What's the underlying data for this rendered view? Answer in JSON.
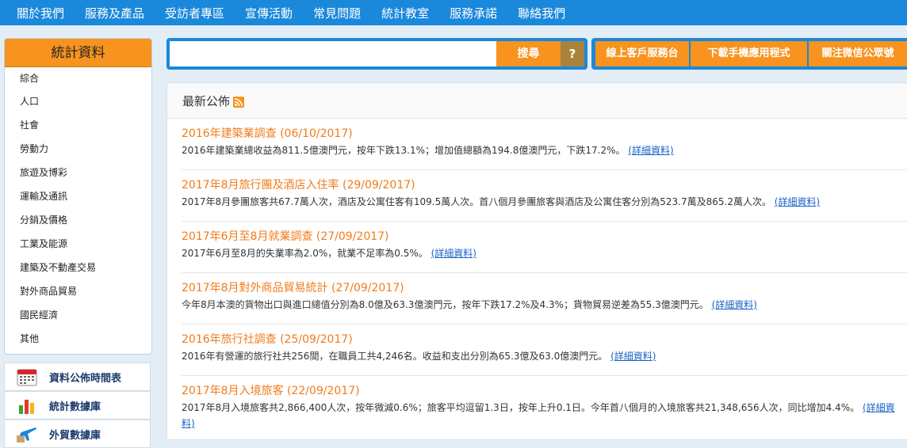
{
  "topnav": {
    "items": [
      "關於我們",
      "服務及產品",
      "受訪者專區",
      "宣傳活動",
      "常見問題",
      "統計教室",
      "服務承諾",
      "聯絡我們"
    ]
  },
  "sidebar": {
    "title": "統計資料",
    "items": [
      "綜合",
      "人口",
      "社會",
      "勞動力",
      "旅遊及博彩",
      "運輸及通訊",
      "分銷及價格",
      "工業及能源",
      "建築及不動產交易",
      "對外商品貿易",
      "國民經濟",
      "其他"
    ]
  },
  "quicklinks": [
    {
      "label": "資料公佈時間表",
      "icon": "calendar-icon"
    },
    {
      "label": "統計數據庫",
      "icon": "bar-chart-icon"
    },
    {
      "label": "外貿數據庫",
      "icon": "airplane-icon"
    }
  ],
  "search": {
    "placeholder": "",
    "value": "",
    "button_label": "搜尋",
    "help_label": "?"
  },
  "actions": [
    "線上客戶服務台",
    "下載手機應用程式",
    "關注微信公眾號"
  ],
  "main": {
    "title": "最新公佈",
    "more_label": "(詳細資料)",
    "news": [
      {
        "title": "2016年建築業調查 (06/10/2017)",
        "desc": "2016年建築業總收益為811.5億澳門元，按年下跌13.1%；增加值總額為194.8億澳門元，下跌17.2%。"
      },
      {
        "title": "2017年8月旅行團及酒店入住率 (29/09/2017)",
        "desc": "2017年8月參團旅客共67.7萬人次，酒店及公寓住客有109.5萬人次。首八個月參團旅客與酒店及公寓住客分別為523.7萬及865.2萬人次。"
      },
      {
        "title": "2017年6月至8月就業調查 (27/09/2017)",
        "desc": "2017年6月至8月的失業率為2.0%，就業不足率為0.5%。"
      },
      {
        "title": "2017年8月對外商品貿易統計 (27/09/2017)",
        "desc": "今年8月本澳的貨物出口與進口總值分別為8.0億及63.3億澳門元，按年下跌17.2%及4.3%；貨物貿易逆差為55.3億澳門元。"
      },
      {
        "title": "2016年旅行社調查 (25/09/2017)",
        "desc": "2016年有營運的旅行社共256間，在職員工共4,246名。收益和支出分別為65.3億及63.0億澳門元。"
      },
      {
        "title": "2017年8月入境旅客 (22/09/2017)",
        "desc": "2017年8月入境旅客共2,866,400人次，按年微減0.6%；旅客平均逗留1.3日，按年上升0.1日。今年首八個月的入境旅客共21,348,656人次，同比增加4.4%。"
      }
    ]
  },
  "colors": {
    "nav_blue": "#1a88db",
    "accent_orange": "#f7931e",
    "news_title": "#f07c1b",
    "link_blue": "#1a62c9"
  }
}
